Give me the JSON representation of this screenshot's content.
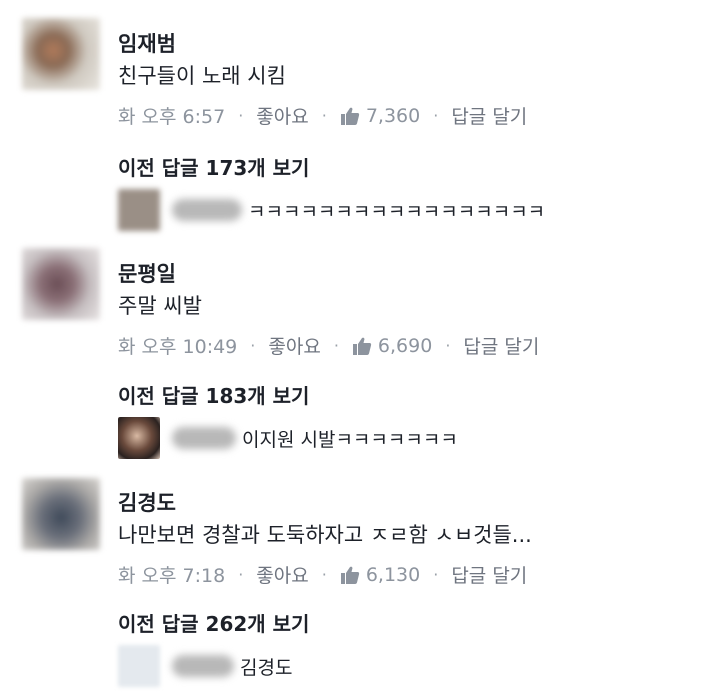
{
  "comments": [
    {
      "author": "임재범",
      "text": "친구들이 노래 시킴",
      "time": "화 오후 6:57",
      "like_action": "좋아요",
      "like_count": "7,360",
      "reply_action": "답글 달기",
      "prev_replies": "이전 답글 173개 보기",
      "reply_text": "ㅋㅋㅋㅋㅋㅋㅋㅋㅋㅋㅋㅋㅋㅋㅋㅋㅋ"
    },
    {
      "author": "문평일",
      "text": "주말 씨발",
      "time": "화 오후 10:49",
      "like_action": "좋아요",
      "like_count": "6,690",
      "reply_action": "답글 달기",
      "prev_replies": "이전 답글 183개 보기",
      "reply_text": "이지원 시발ㅋㅋㅋㅋㅋㅋㅋ"
    },
    {
      "author": "김경도",
      "text": "나만보면 경찰과 도둑하자고 ㅈㄹ함 ㅅㅂ것들...",
      "time": "화 오후 7:18",
      "like_action": "좋아요",
      "like_count": "6,130",
      "reply_action": "답글 달기",
      "prev_replies": "이전 답글 262개 보기",
      "reply_text": "김경도"
    }
  ],
  "icons": {
    "like": "thumbs-up-icon",
    "separator": "·"
  },
  "colors": {
    "meta": "#8d949e",
    "text": "#1d2129",
    "like_icon": "#8d949e"
  }
}
